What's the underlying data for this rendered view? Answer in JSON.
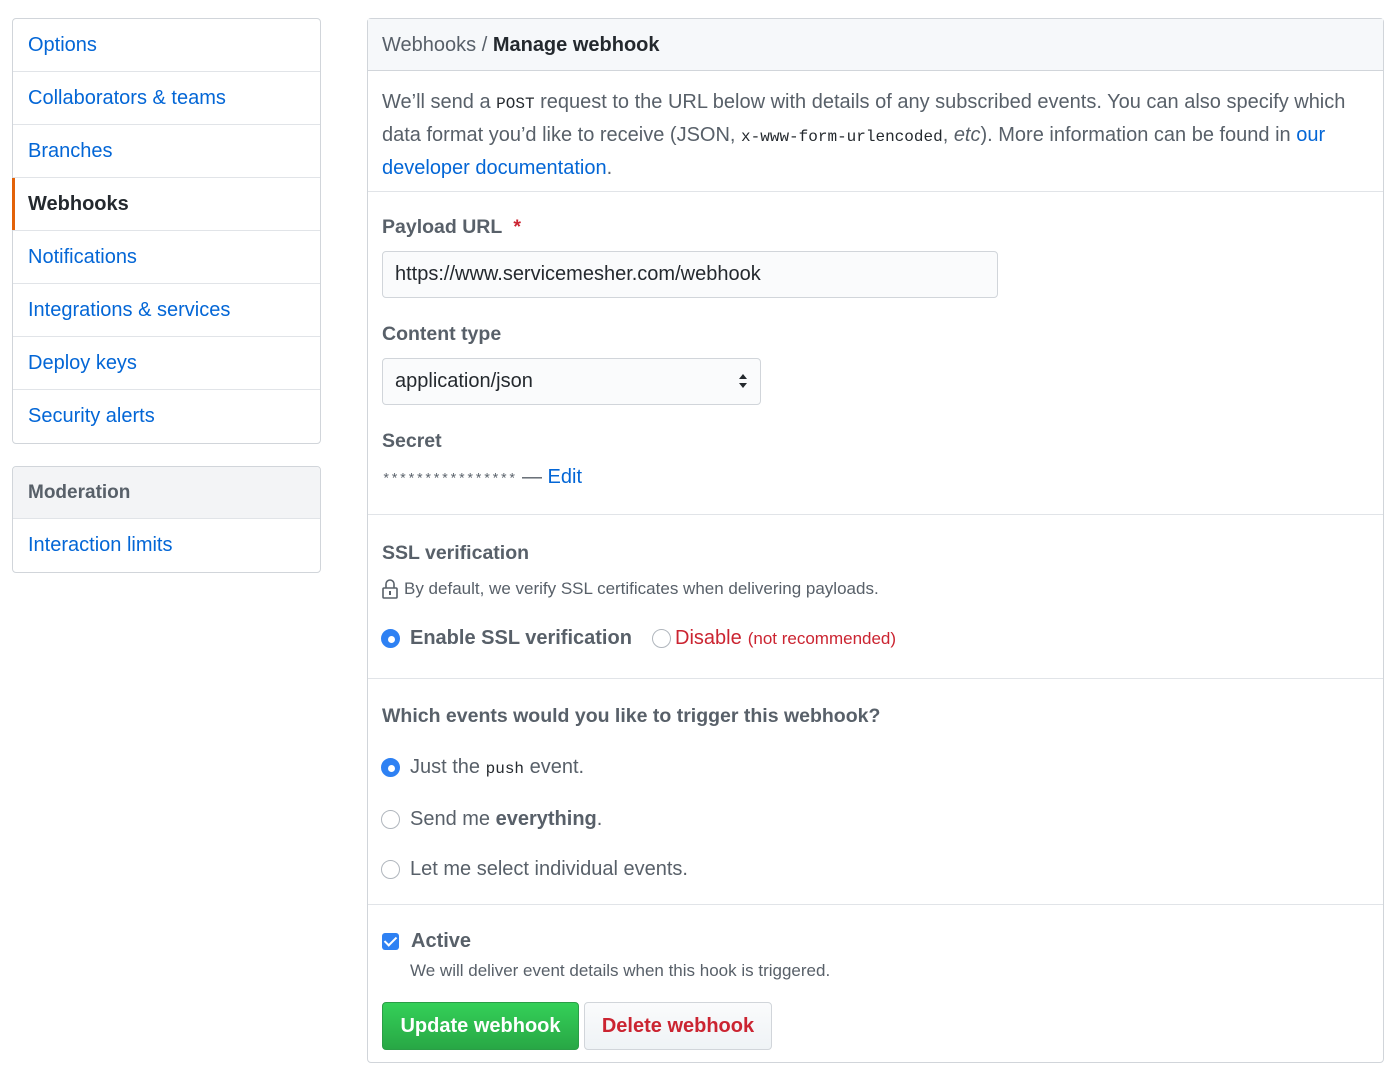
{
  "sidebar": {
    "items": [
      {
        "label": "Options"
      },
      {
        "label": "Collaborators & teams"
      },
      {
        "label": "Branches"
      },
      {
        "label": "Webhooks"
      },
      {
        "label": "Notifications"
      },
      {
        "label": "Integrations & services"
      },
      {
        "label": "Deploy keys"
      },
      {
        "label": "Security alerts"
      }
    ],
    "selected": "Webhooks",
    "moderation": {
      "heading": "Moderation",
      "items": [
        {
          "label": "Interaction limits"
        }
      ]
    }
  },
  "header": {
    "breadcrumb": "Webhooks",
    "separator": " / ",
    "title": "Manage webhook"
  },
  "intro": {
    "p1": "We’ll send a ",
    "post": "POST",
    "p2": " request to the URL below with details of any subscribed events. You can also specify which data format you’d like to receive (JSON, ",
    "urlencoded": "x-www-form-urlencoded",
    "p3": ", ",
    "etc": "etc",
    "p4": "). More information can be found in ",
    "link": "our developer documentation",
    "p5": "."
  },
  "form": {
    "payload_label": "Payload URL",
    "required_mark": "*",
    "payload_value": "https://www.servicemesher.com/webhook",
    "content_type_label": "Content type",
    "content_type_value": "application/json",
    "secret_label": "Secret",
    "secret_value": "****************",
    "secret_dash": " — ",
    "secret_edit": "Edit"
  },
  "ssl": {
    "heading": "SSL verification",
    "note": "By default, we verify SSL certificates when delivering payloads.",
    "enable_label": "Enable SSL verification",
    "disable_label": "Disable",
    "disable_note": "(not recommended)",
    "selected": "enable"
  },
  "events": {
    "heading": "Which events would you like to trigger this webhook?",
    "opt1_a": "Just the ",
    "opt1_code": "push",
    "opt1_b": " event.",
    "opt2_a": "Send me ",
    "opt2_bold": "everything",
    "opt2_b": ".",
    "opt3": "Let me select individual events.",
    "selected": "push"
  },
  "active": {
    "label": "Active",
    "checked": true,
    "description": "We will deliver event details when this hook is triggered."
  },
  "buttons": {
    "update": "Update webhook",
    "delete": "Delete webhook"
  },
  "colors": {
    "link": "#0366d6",
    "selected_accent": "#e36209",
    "danger": "#cb2431",
    "primary_button": "#28a745",
    "radio_checked": "#2e81f3"
  }
}
